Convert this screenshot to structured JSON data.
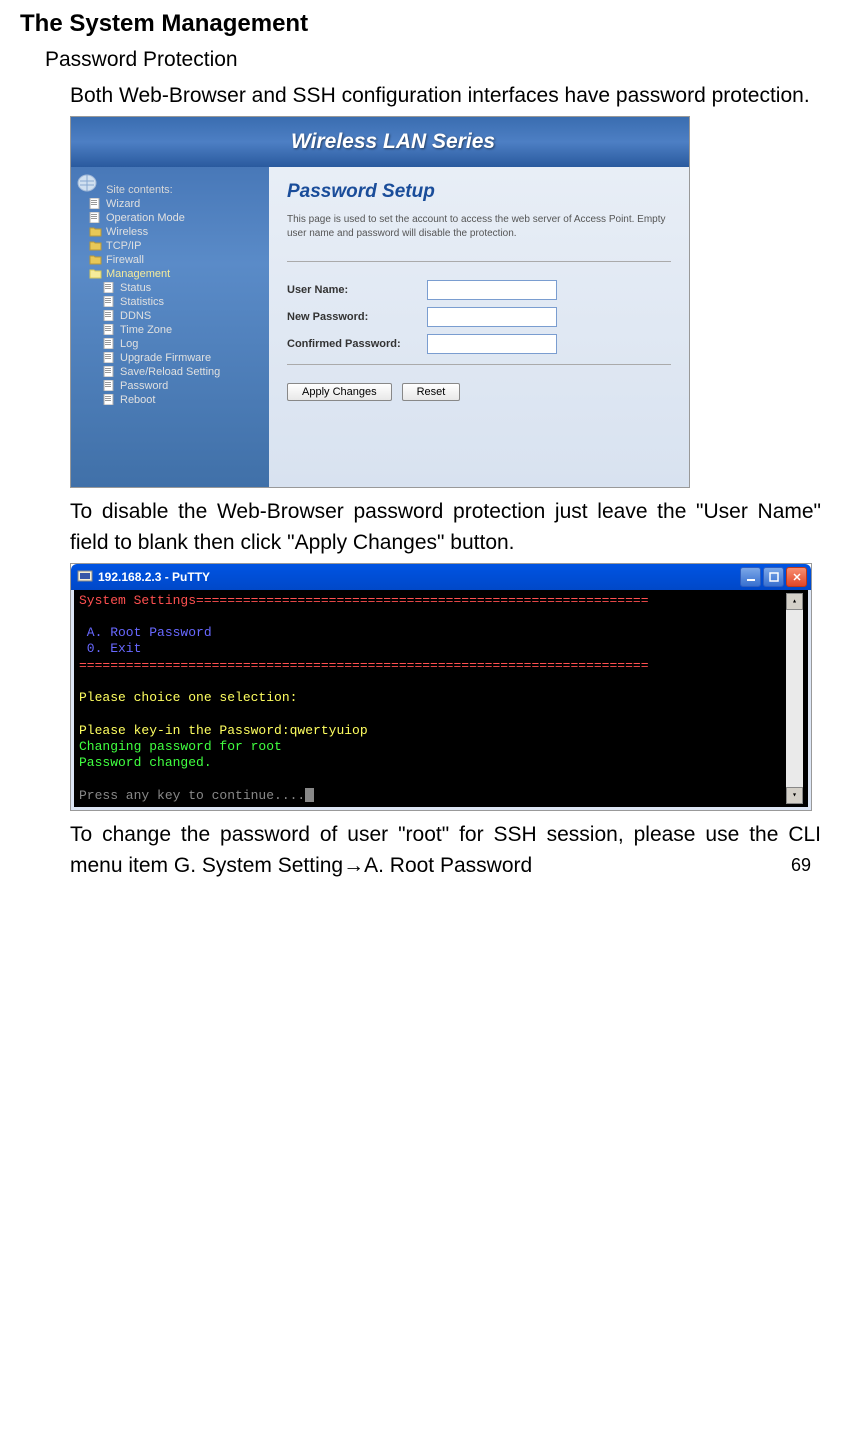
{
  "heading": "The System Management",
  "subheading": "Password Protection",
  "para1": "Both Web-Browser and SSH configuration interfaces have password protection.",
  "para2": "To disable the Web-Browser password protection just leave the \"User Name\" field to blank then click \"Apply Changes\" button.",
  "para3": "To change the password of user \"root\" for SSH session, please use the CLI menu item G. System Setting→A. Root Password",
  "web": {
    "headerTitle": "Wireless LAN Series",
    "sidebarTitle": "Site contents:",
    "sidebar": {
      "items": [
        {
          "label": "Wizard",
          "type": "file"
        },
        {
          "label": "Operation Mode",
          "type": "file"
        },
        {
          "label": "Wireless",
          "type": "folder"
        },
        {
          "label": "TCP/IP",
          "type": "folder"
        },
        {
          "label": "Firewall",
          "type": "folder"
        },
        {
          "label": "Management",
          "type": "folder-open"
        },
        {
          "label": "Status",
          "type": "file",
          "indent": true
        },
        {
          "label": "Statistics",
          "type": "file",
          "indent": true
        },
        {
          "label": "DDNS",
          "type": "file",
          "indent": true
        },
        {
          "label": "Time Zone",
          "type": "file",
          "indent": true
        },
        {
          "label": "Log",
          "type": "file",
          "indent": true
        },
        {
          "label": "Upgrade Firmware",
          "type": "file",
          "indent": true
        },
        {
          "label": "Save/Reload Setting",
          "type": "file",
          "indent": true
        },
        {
          "label": "Password",
          "type": "file",
          "indent": true
        },
        {
          "label": "Reboot",
          "type": "file",
          "indent": true
        }
      ]
    },
    "content": {
      "title": "Password Setup",
      "desc": "This page is used to set the account to access the web server of Access Point. Empty user name and password will disable the protection.",
      "fields": [
        {
          "label": "User Name:"
        },
        {
          "label": "New Password:"
        },
        {
          "label": "Confirmed Password:"
        }
      ],
      "applyBtn": "Apply Changes",
      "resetBtn": "Reset"
    }
  },
  "putty": {
    "title": "192.168.2.3 - PuTTY",
    "lines": [
      {
        "cls": "term-red",
        "text": "System Settings=========================================================="
      },
      {
        "cls": "",
        "text": ""
      },
      {
        "cls": "term-blue",
        "text": " A. Root Password"
      },
      {
        "cls": "term-blue",
        "text": " 0. Exit"
      },
      {
        "cls": "term-red",
        "text": "========================================================================="
      },
      {
        "cls": "",
        "text": ""
      },
      {
        "cls": "term-yellow",
        "text": "Please choice one selection:"
      },
      {
        "cls": "",
        "text": ""
      },
      {
        "cls": "term-yellow",
        "text": "Please key-in the Password:qwertyuiop"
      },
      {
        "cls": "term-green",
        "text": "Changing password for root"
      },
      {
        "cls": "term-green",
        "text": "Password changed."
      },
      {
        "cls": "",
        "text": ""
      },
      {
        "cls": "term-gray",
        "text": "Press any key to continue....",
        "cursor": true
      }
    ]
  },
  "pageNumber": "69"
}
